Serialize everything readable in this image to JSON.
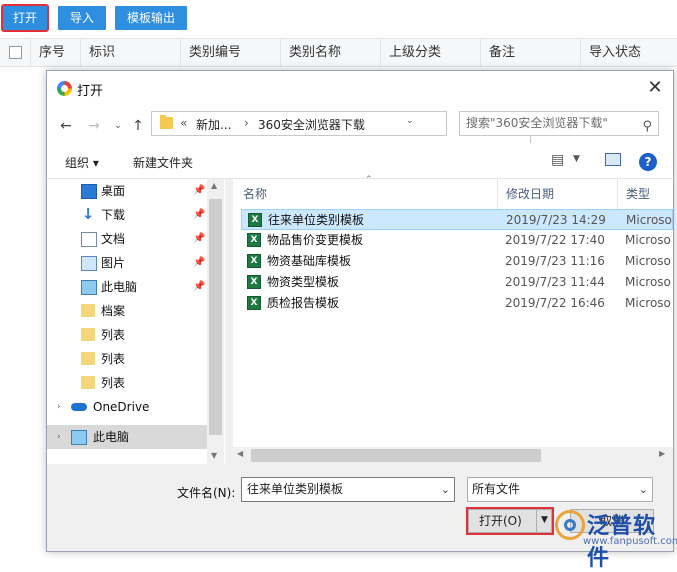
{
  "toolbar": {
    "open_label": "打开",
    "import_label": "导入",
    "export_label": "模板输出"
  },
  "grid": {
    "columns": [
      "序号",
      "标识",
      "类别编号",
      "类别名称",
      "上级分类",
      "备注",
      "导入状态"
    ]
  },
  "dialog": {
    "title": "打开",
    "address": {
      "prefix": "«",
      "crumb1": "新加...",
      "separator": "›",
      "crumb2": "360安全浏览器下载"
    },
    "search_placeholder": "搜索\"360安全浏览器下载\"",
    "commands": {
      "organize": "组织 ▾",
      "new_folder": "新建文件夹"
    },
    "nav_items": [
      {
        "label": "桌面",
        "icon": "desktop-icon",
        "pinned": true
      },
      {
        "label": "下载",
        "icon": "download-icon",
        "pinned": true
      },
      {
        "label": "文档",
        "icon": "document-icon",
        "pinned": true
      },
      {
        "label": "图片",
        "icon": "picture-icon",
        "pinned": true
      },
      {
        "label": "此电脑",
        "icon": "computer-icon",
        "pinned": true
      },
      {
        "label": "档案",
        "icon": "folder-icon",
        "pinned": false
      },
      {
        "label": "列表",
        "icon": "folder-icon",
        "pinned": false
      },
      {
        "label": "列表",
        "icon": "folder-icon",
        "pinned": false
      },
      {
        "label": "列表",
        "icon": "folder-icon",
        "pinned": false
      },
      {
        "label": "OneDrive",
        "icon": "cloud-icon",
        "pinned": false
      },
      {
        "label": "此电脑",
        "icon": "computer-icon",
        "pinned": false
      }
    ],
    "columns": {
      "name": "名称",
      "date": "修改日期",
      "type": "类型"
    },
    "files": [
      {
        "name": "往来单位类别模板",
        "date": "2019/7/23 14:29",
        "type": "Microso",
        "selected": true
      },
      {
        "name": "物品售价变更模板",
        "date": "2019/7/22 17:40",
        "type": "Microso",
        "selected": false
      },
      {
        "name": "物资基础库模板",
        "date": "2019/7/23 11:16",
        "type": "Microso",
        "selected": false
      },
      {
        "name": "物资类型模板",
        "date": "2019/7/23 11:44",
        "type": "Microso",
        "selected": false
      },
      {
        "name": "质检报告模板",
        "date": "2019/7/22 16:46",
        "type": "Microso",
        "selected": false
      }
    ],
    "filename_label": "文件名(N):",
    "filename_value": "往来单位类别模板",
    "filetype_value": "所有文件",
    "open_button": "打开(O)",
    "cancel_button": "取消",
    "close_glyph": "✕"
  },
  "watermark": {
    "text": "泛普软件",
    "url": "www.fanpusoft.com"
  },
  "colors": {
    "toolbar_button": "#2e8ee0",
    "highlight_outline": "#e0303a",
    "selected_row": "#cce8ff"
  }
}
